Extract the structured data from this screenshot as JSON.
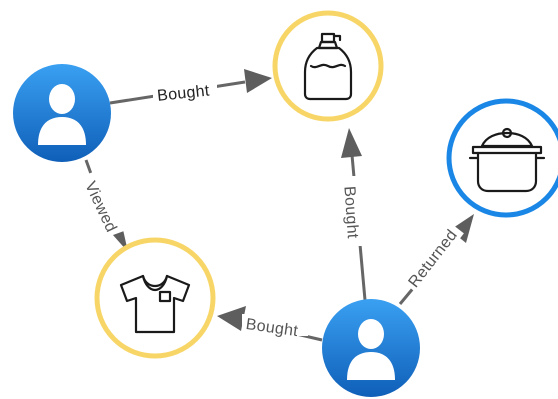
{
  "edges": {
    "bought_1": "Bought",
    "viewed": "Viewed",
    "bought_2": "Bought",
    "bought_3": "Bought",
    "returned": "Returned"
  },
  "colors": {
    "user_gradient_top": "#3aa0f2",
    "user_gradient_bottom": "#0f5fb8",
    "product_ring": "#f7d667",
    "returned_ring": "#1a87e6",
    "edge": "#666666"
  },
  "nodes": {
    "customer_1": "person-icon",
    "customer_2": "person-icon",
    "product_bottle": "soap-bottle-icon",
    "product_shirt": "t-shirt-icon",
    "product_pot": "cooking-pot-icon"
  }
}
